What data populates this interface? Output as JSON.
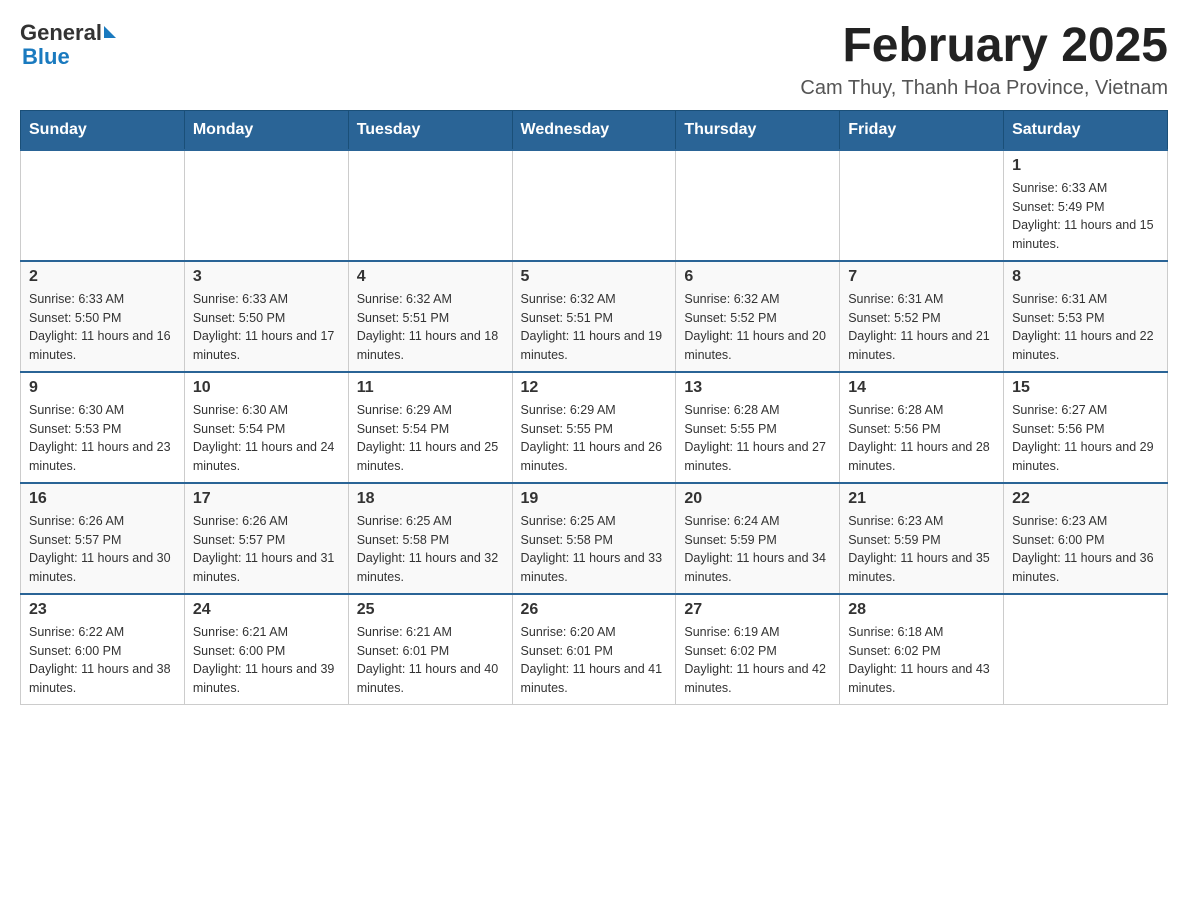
{
  "header": {
    "logo": {
      "general": "General",
      "blue": "Blue"
    },
    "title": "February 2025",
    "location": "Cam Thuy, Thanh Hoa Province, Vietnam"
  },
  "weekdays": [
    "Sunday",
    "Monday",
    "Tuesday",
    "Wednesday",
    "Thursday",
    "Friday",
    "Saturday"
  ],
  "weeks": [
    {
      "days": [
        {
          "number": "",
          "info": ""
        },
        {
          "number": "",
          "info": ""
        },
        {
          "number": "",
          "info": ""
        },
        {
          "number": "",
          "info": ""
        },
        {
          "number": "",
          "info": ""
        },
        {
          "number": "",
          "info": ""
        },
        {
          "number": "1",
          "info": "Sunrise: 6:33 AM\nSunset: 5:49 PM\nDaylight: 11 hours and 15 minutes."
        }
      ]
    },
    {
      "days": [
        {
          "number": "2",
          "info": "Sunrise: 6:33 AM\nSunset: 5:50 PM\nDaylight: 11 hours and 16 minutes."
        },
        {
          "number": "3",
          "info": "Sunrise: 6:33 AM\nSunset: 5:50 PM\nDaylight: 11 hours and 17 minutes."
        },
        {
          "number": "4",
          "info": "Sunrise: 6:32 AM\nSunset: 5:51 PM\nDaylight: 11 hours and 18 minutes."
        },
        {
          "number": "5",
          "info": "Sunrise: 6:32 AM\nSunset: 5:51 PM\nDaylight: 11 hours and 19 minutes."
        },
        {
          "number": "6",
          "info": "Sunrise: 6:32 AM\nSunset: 5:52 PM\nDaylight: 11 hours and 20 minutes."
        },
        {
          "number": "7",
          "info": "Sunrise: 6:31 AM\nSunset: 5:52 PM\nDaylight: 11 hours and 21 minutes."
        },
        {
          "number": "8",
          "info": "Sunrise: 6:31 AM\nSunset: 5:53 PM\nDaylight: 11 hours and 22 minutes."
        }
      ]
    },
    {
      "days": [
        {
          "number": "9",
          "info": "Sunrise: 6:30 AM\nSunset: 5:53 PM\nDaylight: 11 hours and 23 minutes."
        },
        {
          "number": "10",
          "info": "Sunrise: 6:30 AM\nSunset: 5:54 PM\nDaylight: 11 hours and 24 minutes."
        },
        {
          "number": "11",
          "info": "Sunrise: 6:29 AM\nSunset: 5:54 PM\nDaylight: 11 hours and 25 minutes."
        },
        {
          "number": "12",
          "info": "Sunrise: 6:29 AM\nSunset: 5:55 PM\nDaylight: 11 hours and 26 minutes."
        },
        {
          "number": "13",
          "info": "Sunrise: 6:28 AM\nSunset: 5:55 PM\nDaylight: 11 hours and 27 minutes."
        },
        {
          "number": "14",
          "info": "Sunrise: 6:28 AM\nSunset: 5:56 PM\nDaylight: 11 hours and 28 minutes."
        },
        {
          "number": "15",
          "info": "Sunrise: 6:27 AM\nSunset: 5:56 PM\nDaylight: 11 hours and 29 minutes."
        }
      ]
    },
    {
      "days": [
        {
          "number": "16",
          "info": "Sunrise: 6:26 AM\nSunset: 5:57 PM\nDaylight: 11 hours and 30 minutes."
        },
        {
          "number": "17",
          "info": "Sunrise: 6:26 AM\nSunset: 5:57 PM\nDaylight: 11 hours and 31 minutes."
        },
        {
          "number": "18",
          "info": "Sunrise: 6:25 AM\nSunset: 5:58 PM\nDaylight: 11 hours and 32 minutes."
        },
        {
          "number": "19",
          "info": "Sunrise: 6:25 AM\nSunset: 5:58 PM\nDaylight: 11 hours and 33 minutes."
        },
        {
          "number": "20",
          "info": "Sunrise: 6:24 AM\nSunset: 5:59 PM\nDaylight: 11 hours and 34 minutes."
        },
        {
          "number": "21",
          "info": "Sunrise: 6:23 AM\nSunset: 5:59 PM\nDaylight: 11 hours and 35 minutes."
        },
        {
          "number": "22",
          "info": "Sunrise: 6:23 AM\nSunset: 6:00 PM\nDaylight: 11 hours and 36 minutes."
        }
      ]
    },
    {
      "days": [
        {
          "number": "23",
          "info": "Sunrise: 6:22 AM\nSunset: 6:00 PM\nDaylight: 11 hours and 38 minutes."
        },
        {
          "number": "24",
          "info": "Sunrise: 6:21 AM\nSunset: 6:00 PM\nDaylight: 11 hours and 39 minutes."
        },
        {
          "number": "25",
          "info": "Sunrise: 6:21 AM\nSunset: 6:01 PM\nDaylight: 11 hours and 40 minutes."
        },
        {
          "number": "26",
          "info": "Sunrise: 6:20 AM\nSunset: 6:01 PM\nDaylight: 11 hours and 41 minutes."
        },
        {
          "number": "27",
          "info": "Sunrise: 6:19 AM\nSunset: 6:02 PM\nDaylight: 11 hours and 42 minutes."
        },
        {
          "number": "28",
          "info": "Sunrise: 6:18 AM\nSunset: 6:02 PM\nDaylight: 11 hours and 43 minutes."
        },
        {
          "number": "",
          "info": ""
        }
      ]
    }
  ]
}
